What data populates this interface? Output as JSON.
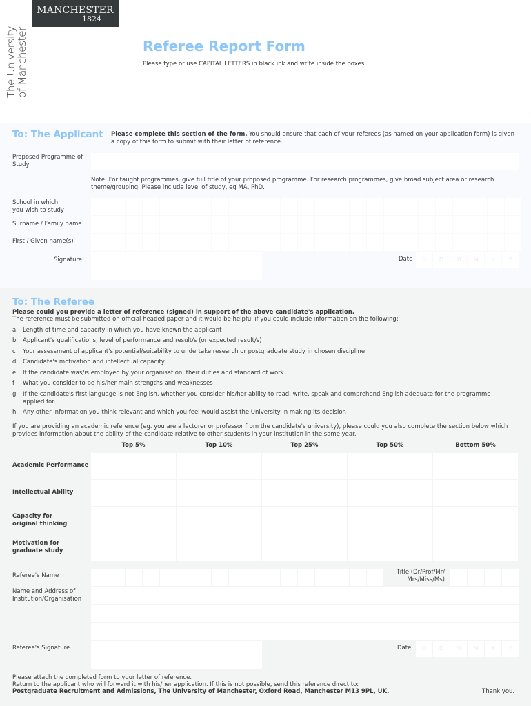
{
  "branding": {
    "logo_name": "MANCHESTER",
    "logo_year": "1824",
    "vertical_line1": "The University",
    "vertical_line2": "of Manchester"
  },
  "header": {
    "title": "Referee Report Form",
    "instruction": "Please type or use CAPITAL LETTERS in black ink and write inside the boxes"
  },
  "applicant": {
    "section_title": "To: The Applicant",
    "intro_bold": "Please complete this section of the form.",
    "intro_rest": " You should ensure that each of your referees (as named on your application form) is given a copy of this form to submit with their letter of reference.",
    "programme_label": "Proposed Programme of Study",
    "programme_value": "",
    "note": "Note: For taught programmes, give full title of your proposed programme. For research programmes, give broad subject area or research theme/grouping. Please include level of study, eg MA, PhD.",
    "school_label_1": "School in which",
    "school_label_2": "you wish to study",
    "surname_label": "Surname / Family name",
    "firstname_label": "First / Given name(s)",
    "signature_label": "Signature",
    "date_label": "Date",
    "date_placeholders": [
      "D",
      "D",
      "M",
      "M",
      "Y",
      "Y"
    ]
  },
  "referee": {
    "section_title": "To: The Referee",
    "intro_bold": "Please could you provide a letter of reference (signed) in support of the above candidate's application.",
    "intro_rest": "The reference must be submitted on official headed paper and it would be helpful if you could include information on the following:",
    "items": [
      {
        "letter": "a",
        "text": "Length of time and capacity in which you have known the applicant"
      },
      {
        "letter": "b",
        "text": "Applicant's qualifications, level of performance and result/s (or expected result/s)"
      },
      {
        "letter": "c",
        "text": "Your assessment of applicant's potential/suitability to undertake research or postgraduate study in chosen discipline"
      },
      {
        "letter": "d",
        "text": "Candidate's motivation and intellectual capacity"
      },
      {
        "letter": "e",
        "text": "If the candidate was/is employed by your organisation, their duties and standard of work"
      },
      {
        "letter": "f",
        "text": "What you consider to be his/her main strengths and weaknesses"
      },
      {
        "letter": "g",
        "text": "If the candidate's first language is not English, whether you consider his/her ability to read, write, speak and comprehend English adequate for the programme applied for."
      },
      {
        "letter": "h",
        "text": "Any other information you think relevant and which you feel would assist the University in making its decision"
      }
    ],
    "academic_note": "If you are providing an academic reference (eg. you are a lecturer or professor from the candidate's university), please could you also complete the section below which provides information about the ability of the candidate relative to other students in your institution in the same year.",
    "rank_columns": [
      "Top 5%",
      "Top 10%",
      "Top 25%",
      "Top 50%",
      "Bottom 50%"
    ],
    "rank_rows": [
      {
        "label_1": "Academic Performance",
        "label_2": ""
      },
      {
        "label_1": "Intellectual Ability",
        "label_2": ""
      },
      {
        "label_1": "Capacity for",
        "label_2": "original thinking"
      },
      {
        "label_1": "Motivation for",
        "label_2": "graduate study"
      }
    ],
    "name_label": "Referee's Name",
    "title_label_1": "Title (Dr/Prof/Mr/",
    "title_label_2": "Mrs/Miss/Ms)",
    "address_label_1": "Name and Address of",
    "address_label_2": "Institution/Organisation",
    "signature_label": "Referee's Signature",
    "date_label": "Date",
    "date_placeholders": [
      "D",
      "D",
      "M",
      "M",
      "Y",
      "Y"
    ]
  },
  "footer": {
    "line1": "Please attach the completed form to your letter of reference.",
    "line2": "Return to the applicant who will forward it with his/her application. If this is not possible, send this reference direct to:",
    "address": "Postgraduate Recruitment and Admissions, The University of Manchester, Oxford Road, Manchester M13 9PL, UK.",
    "thanks": "Thank you."
  }
}
